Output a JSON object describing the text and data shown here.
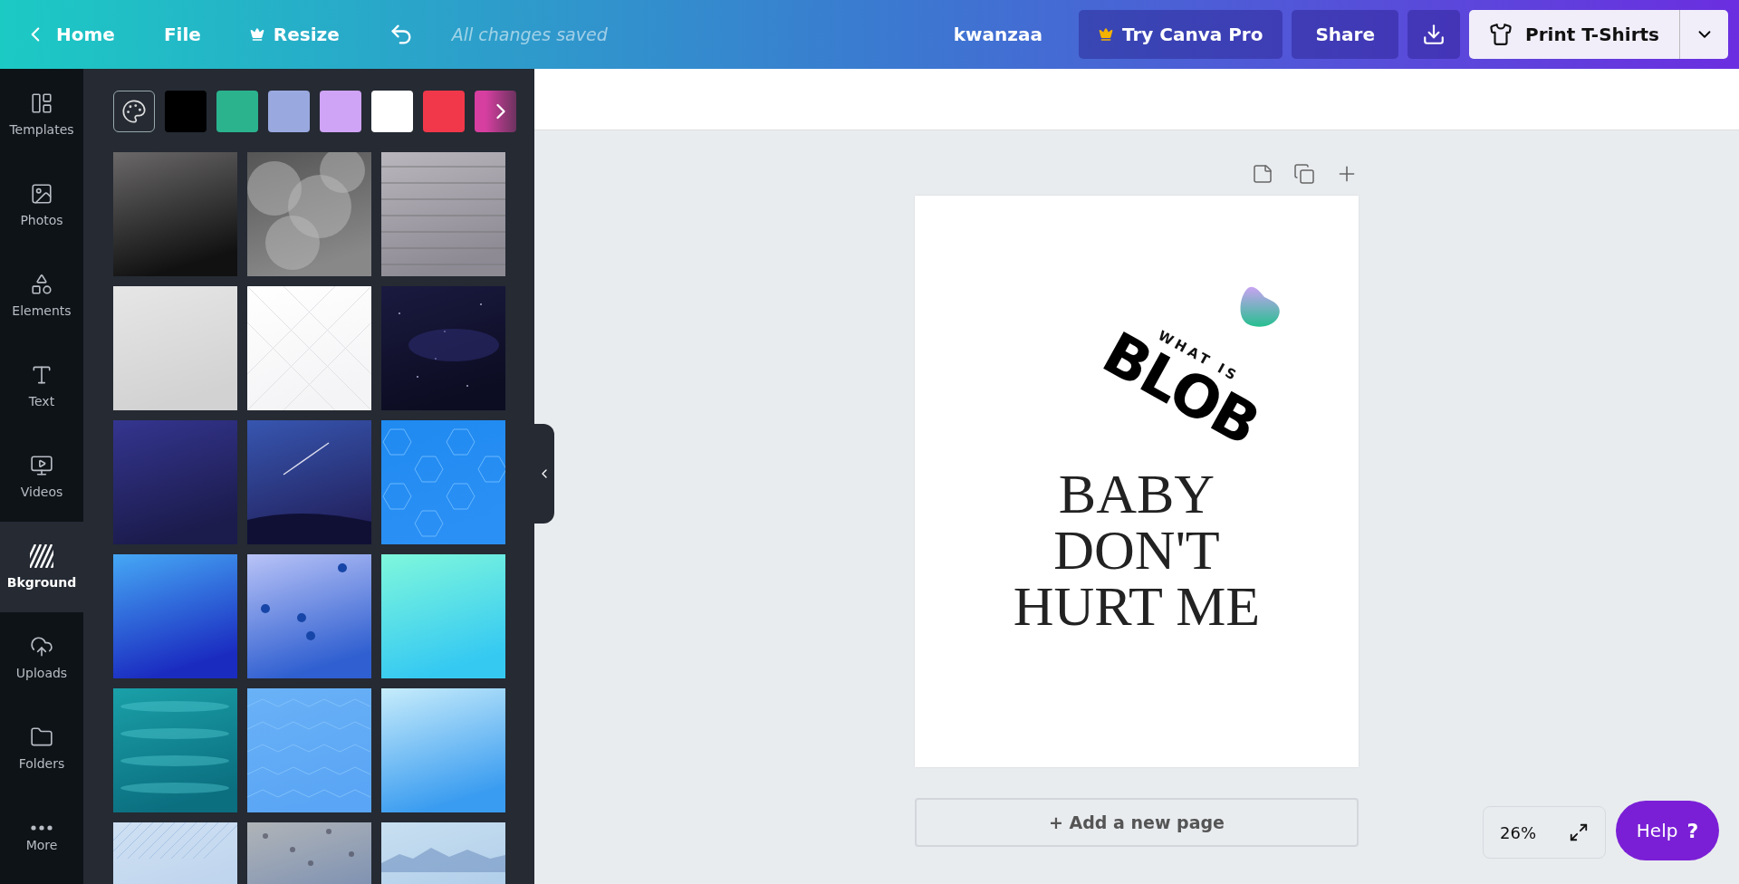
{
  "top_bar": {
    "home": "Home",
    "file": "File",
    "resize": "Resize",
    "status": "All changes saved",
    "title": "kwanzaa",
    "try_pro": "Try Canva Pro",
    "share": "Share",
    "print": "Print T-Shirts"
  },
  "nav": [
    {
      "label": "Templates",
      "selected": false
    },
    {
      "label": "Photos",
      "selected": false
    },
    {
      "label": "Elements",
      "selected": false
    },
    {
      "label": "Text",
      "selected": false
    },
    {
      "label": "Videos",
      "selected": false
    },
    {
      "label": "Bkground",
      "selected": true
    },
    {
      "label": "Uploads",
      "selected": false
    },
    {
      "label": "Folders",
      "selected": false
    },
    {
      "label": "More",
      "selected": false
    }
  ],
  "swatches": [
    {
      "color": "#000000"
    },
    {
      "color": "#2bb38e"
    },
    {
      "color": "#9aa8e0"
    },
    {
      "color": "#cfa3f5"
    },
    {
      "color": "#ffffff"
    },
    {
      "color": "#f0384a"
    },
    {
      "color": "#d63fa0"
    }
  ],
  "design": {
    "small_title": "WHAT IS",
    "big_title": "BLOB",
    "headline": [
      "BABY",
      "DON'T",
      "HURT ME"
    ]
  },
  "add_page": "+ Add a new page",
  "zoom": "26%",
  "help": {
    "label": "Help",
    "mark": "?"
  }
}
